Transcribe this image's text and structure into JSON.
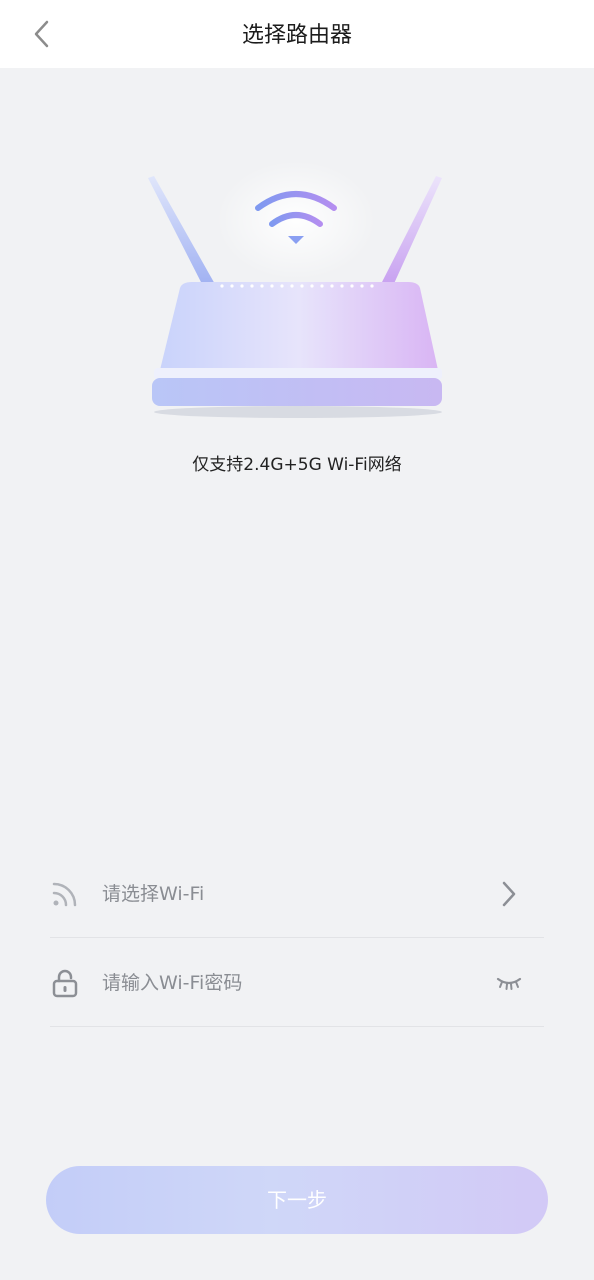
{
  "header": {
    "title": "选择路由器",
    "back_icon": "chevron-left-icon"
  },
  "main": {
    "illustration_icon": "router-icon",
    "support_note": "仅支持2.4G+5G Wi-Fi网络"
  },
  "form": {
    "wifi": {
      "icon": "wifi-signal-icon",
      "placeholder": "请选择Wi-Fi",
      "trailing_icon": "chevron-right-icon"
    },
    "password": {
      "icon": "lock-icon",
      "placeholder": "请输入Wi-Fi密码",
      "trailing_icon": "eye-closed-icon"
    }
  },
  "footer": {
    "next_label": "下一步"
  },
  "colors": {
    "background": "#f1f2f4",
    "header_bg": "#ffffff",
    "button_gradient_start": "#c3cdf8",
    "button_gradient_end": "#d2c9f6",
    "placeholder_text": "#8a8d93"
  }
}
